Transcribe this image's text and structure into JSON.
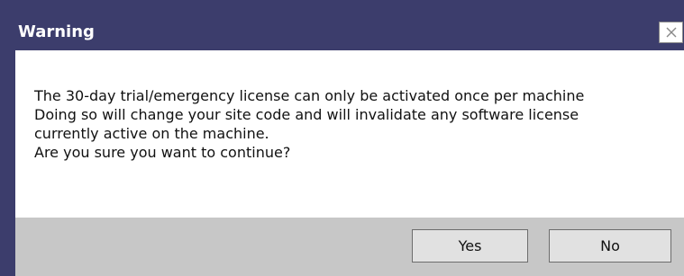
{
  "dialog": {
    "title": "Warning",
    "close_icon": "close-icon",
    "message_lines": [
      "The 30-day trial/emergency license can only be activated once per machine",
      "Doing so will change your site code and will invalidate any software license",
      "currently active on the machine.",
      "Are you sure you want to continue?"
    ],
    "buttons": {
      "yes_label": "Yes",
      "no_label": "No"
    }
  },
  "colors": {
    "titlebar": "#3c3d6c",
    "content_background": "#ffffff",
    "footer_background": "#c7c7c7",
    "button_background": "#e1e1e1"
  }
}
